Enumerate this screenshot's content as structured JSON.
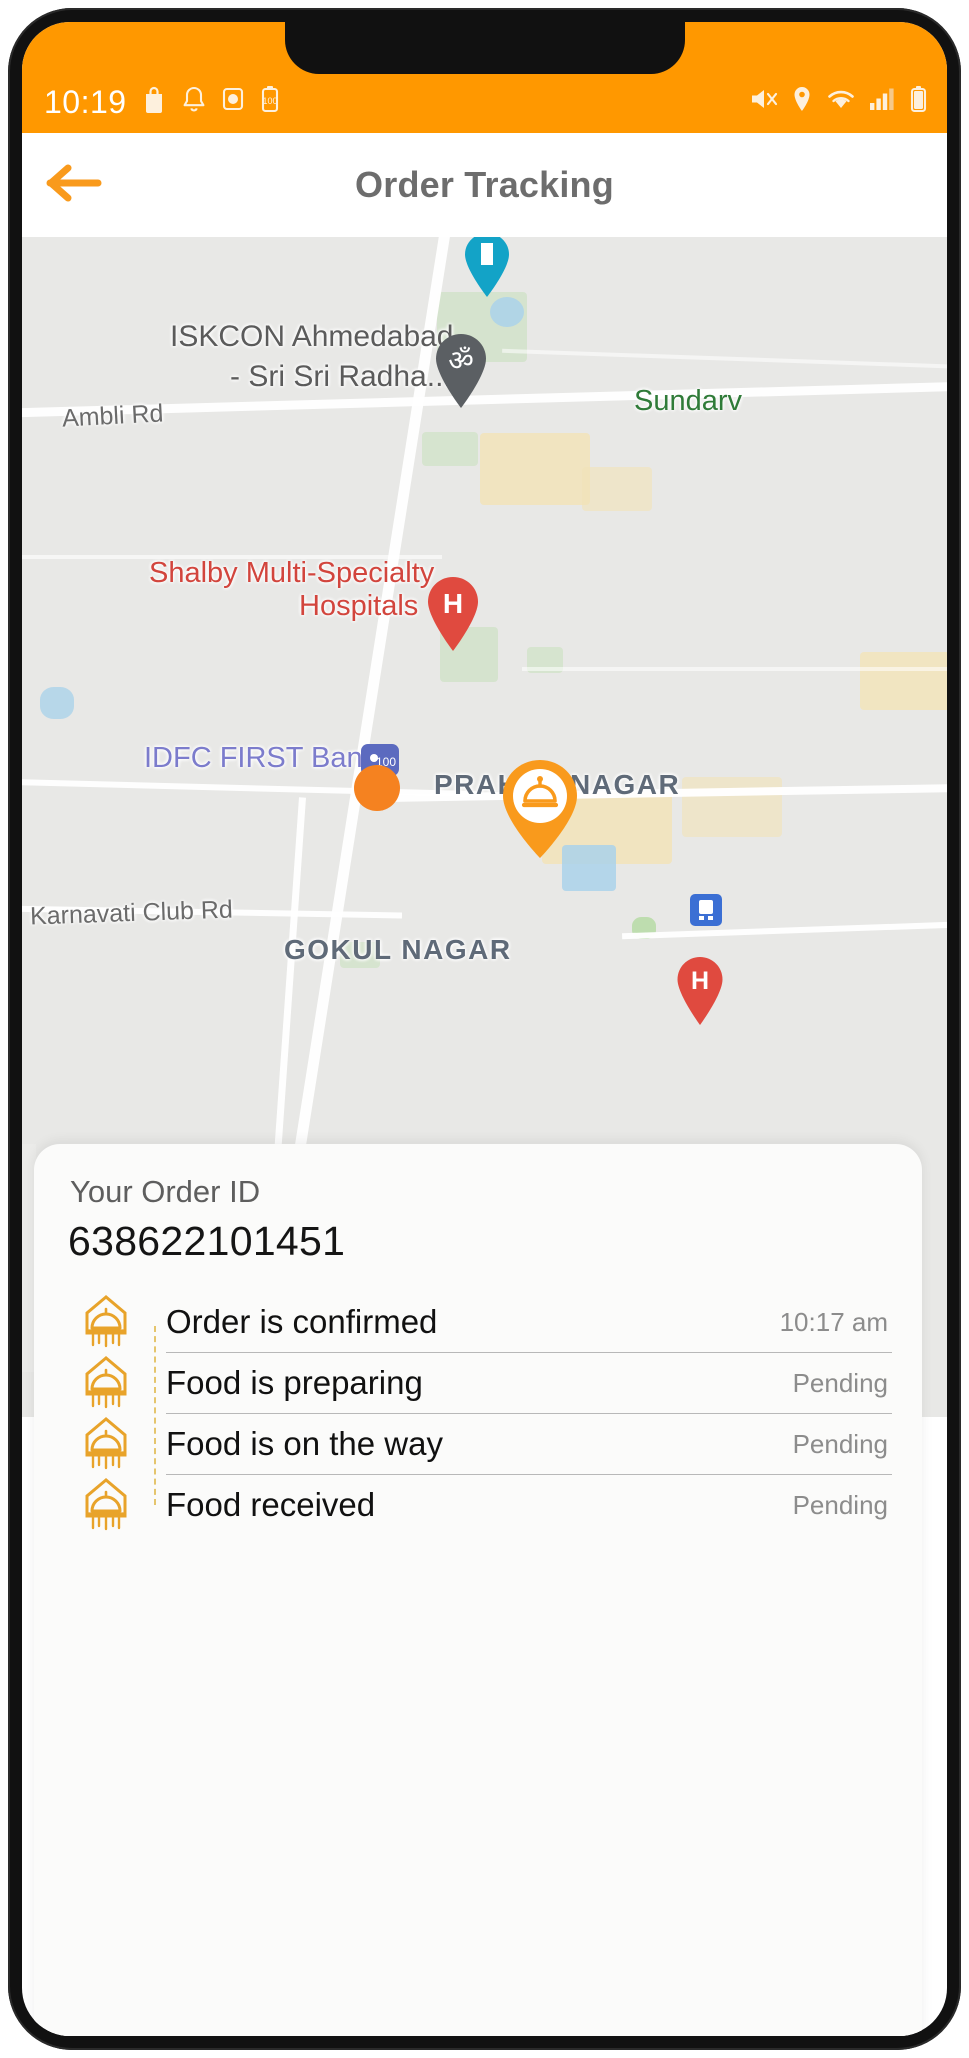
{
  "status_bar": {
    "clock": "10:19",
    "left_icons": [
      "shopping-bag-icon",
      "bell-icon",
      "camera-icon",
      "battery-saver-icon"
    ],
    "right_icons": [
      "volume-mute-icon",
      "location-icon",
      "wifi-icon",
      "cellular-signal-icon",
      "battery-icon"
    ],
    "battery_level_text": "100",
    "background_color": "#FF9800"
  },
  "header": {
    "title": "Order Tracking",
    "back_icon": "arrow-left-icon",
    "accent_color": "#F99A1C"
  },
  "map": {
    "labels": [
      {
        "text": "ISKCON Ahmedabad",
        "kind": "poi"
      },
      {
        "text": "- Sri Sri Radha...",
        "kind": "poi"
      },
      {
        "text": "Ambli Rd",
        "kind": "road"
      },
      {
        "text": "Sundarv",
        "kind": "green"
      },
      {
        "text": "Shalby Multi-Specialty",
        "kind": "red"
      },
      {
        "text": "Hospitals",
        "kind": "red"
      },
      {
        "text": "IDFC FIRST Bank",
        "kind": "blue"
      },
      {
        "text": "PRAH",
        "kind": "area"
      },
      {
        "text": "NAGAR",
        "kind": "area"
      },
      {
        "text": "Karnavati Club Rd",
        "kind": "road"
      },
      {
        "text": "GOKUL NAGAR",
        "kind": "area"
      }
    ],
    "markers": [
      {
        "name": "movie-theater-pin",
        "glyph": "Ἲc",
        "color": "#13A3C7"
      },
      {
        "name": "temple-pin",
        "glyph": "ॐ",
        "color": "#5B5F63"
      },
      {
        "name": "hospital-pin",
        "glyph": "H",
        "color": "#E04A3F"
      },
      {
        "name": "bank-pin",
        "glyph": "100",
        "color": "#5B6ABF"
      },
      {
        "name": "train-pin",
        "glyph": "Ὠ6",
        "color": "#3B6FD4"
      },
      {
        "name": "hospital-pin-2",
        "glyph": "H",
        "color": "#E04A3F"
      }
    ],
    "driver_marker": {
      "name": "driver-location-dot",
      "color": "#F58220"
    },
    "restaurant_marker": {
      "name": "restaurant-bell-marker",
      "color": "#F99A1C"
    }
  },
  "order": {
    "id_label": "Your Order ID",
    "id_value": "638622101451",
    "steps": [
      {
        "label": "Order is confirmed",
        "status": "10:17 am",
        "icon": "restaurant-bell-icon",
        "done": true
      },
      {
        "label": "Food is preparing",
        "status": "Pending",
        "icon": "restaurant-bell-icon",
        "done": false
      },
      {
        "label": "Food is on the way",
        "status": "Pending",
        "icon": "restaurant-bell-icon",
        "done": false
      },
      {
        "label": "Food received",
        "status": "Pending",
        "icon": "restaurant-bell-icon",
        "done": false
      }
    ]
  }
}
